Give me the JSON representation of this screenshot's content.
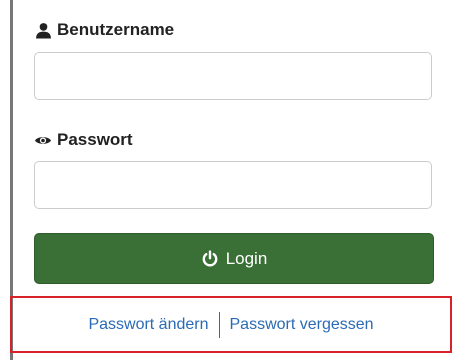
{
  "form": {
    "username_label": "Benutzername",
    "username_value": "",
    "username_placeholder": "",
    "password_label": "Passwort",
    "password_value": "",
    "password_placeholder": "",
    "login_label": "Login"
  },
  "links": {
    "change_password": "Passwort ändern",
    "forgot_password": "Passwort vergessen"
  },
  "icons": {
    "username": "user-icon",
    "password": "eye-icon",
    "login": "power-icon"
  },
  "colors": {
    "login_button": "#3a7035",
    "link": "#2a6bb5",
    "highlight": "#d6232a"
  }
}
